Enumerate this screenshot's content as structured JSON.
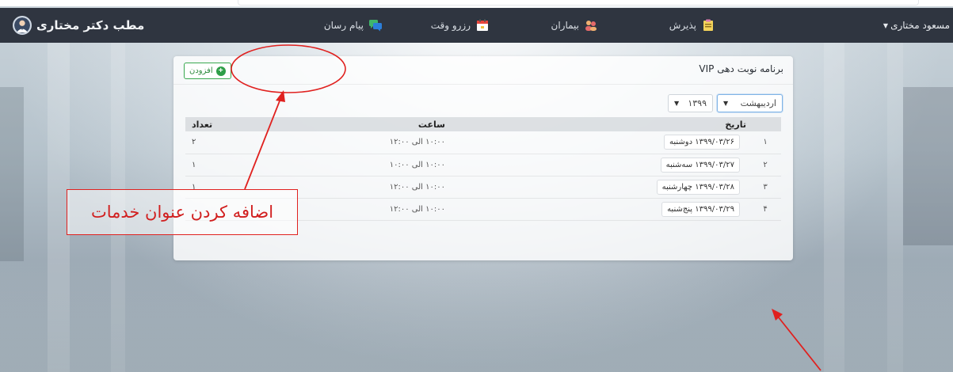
{
  "app": {
    "brand": "مطب دکتر مختاری"
  },
  "nav": {
    "user": "مسعود مختاری",
    "items": [
      {
        "label": "پذیرش",
        "icon": "clipboard-icon"
      },
      {
        "label": "بیماران",
        "icon": "patients-icon"
      },
      {
        "label": "رزرو وقت",
        "icon": "calendar-icon"
      },
      {
        "label": "پیام رسان",
        "icon": "chat-icon"
      }
    ]
  },
  "card": {
    "title": "برنامه نوبت دهی VIP",
    "add_label": "افزودن",
    "month_select": "اردیبهشت",
    "year_select": "۱۳۹۹"
  },
  "table": {
    "headers": {
      "num": "",
      "date": "تاریخ",
      "time": "ساعت",
      "count": "تعداد"
    },
    "rows": [
      {
        "num": "۱",
        "date": "۱۳۹۹/۰۳/۲۶ دوشنبه",
        "time": "۱۰:۰۰ الی ۱۲:۰۰",
        "count": "۲"
      },
      {
        "num": "۲",
        "date": "۱۳۹۹/۰۳/۲۷ سه‌شنبه",
        "time": "۱۰:۰۰ الی ۱۰:۰۰",
        "count": "۱"
      },
      {
        "num": "۳",
        "date": "۱۳۹۹/۰۳/۲۸ چهارشنبه",
        "time": "۱۰:۰۰ الی ۱۲:۰۰",
        "count": "۱"
      },
      {
        "num": "۴",
        "date": "۱۳۹۹/۰۳/۲۹ پنج‌شنبه",
        "time": "۱۰:۰۰ الی ۱۲:۰۰",
        "count": ""
      }
    ]
  },
  "annotation": {
    "text": "اضافه کردن عنوان خدمات"
  },
  "colors": {
    "navbar": "#2f3540",
    "accent_green": "#2e9e48",
    "annotation_red": "#e0211f"
  }
}
